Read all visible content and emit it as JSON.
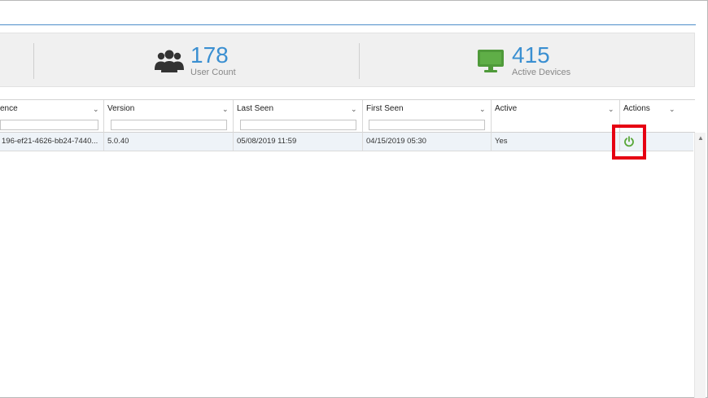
{
  "stats": {
    "users": {
      "value": "178",
      "label": "User Count",
      "icon": "users-icon",
      "color": "#3a8fd1"
    },
    "devices": {
      "value": "415",
      "label": "Active Devices",
      "icon": "monitor-icon",
      "color": "#4f9a3a"
    }
  },
  "grid": {
    "columns": [
      {
        "title": "ence"
      },
      {
        "title": "Version"
      },
      {
        "title": "Last Seen"
      },
      {
        "title": "First Seen"
      },
      {
        "title": "Active"
      },
      {
        "title": "Actions"
      }
    ],
    "rows": [
      {
        "id_fragment": "196-ef21-4626-bb24-7440...",
        "version": "5.0.40",
        "last_seen": "05/08/2019 11:59",
        "first_seen": "04/15/2019 05:30",
        "active": "Yes",
        "action_icon": "power-icon"
      }
    ]
  },
  "colors": {
    "accent": "#3a8fd1",
    "highlight": "#e60012",
    "power": "#5aa83a"
  }
}
